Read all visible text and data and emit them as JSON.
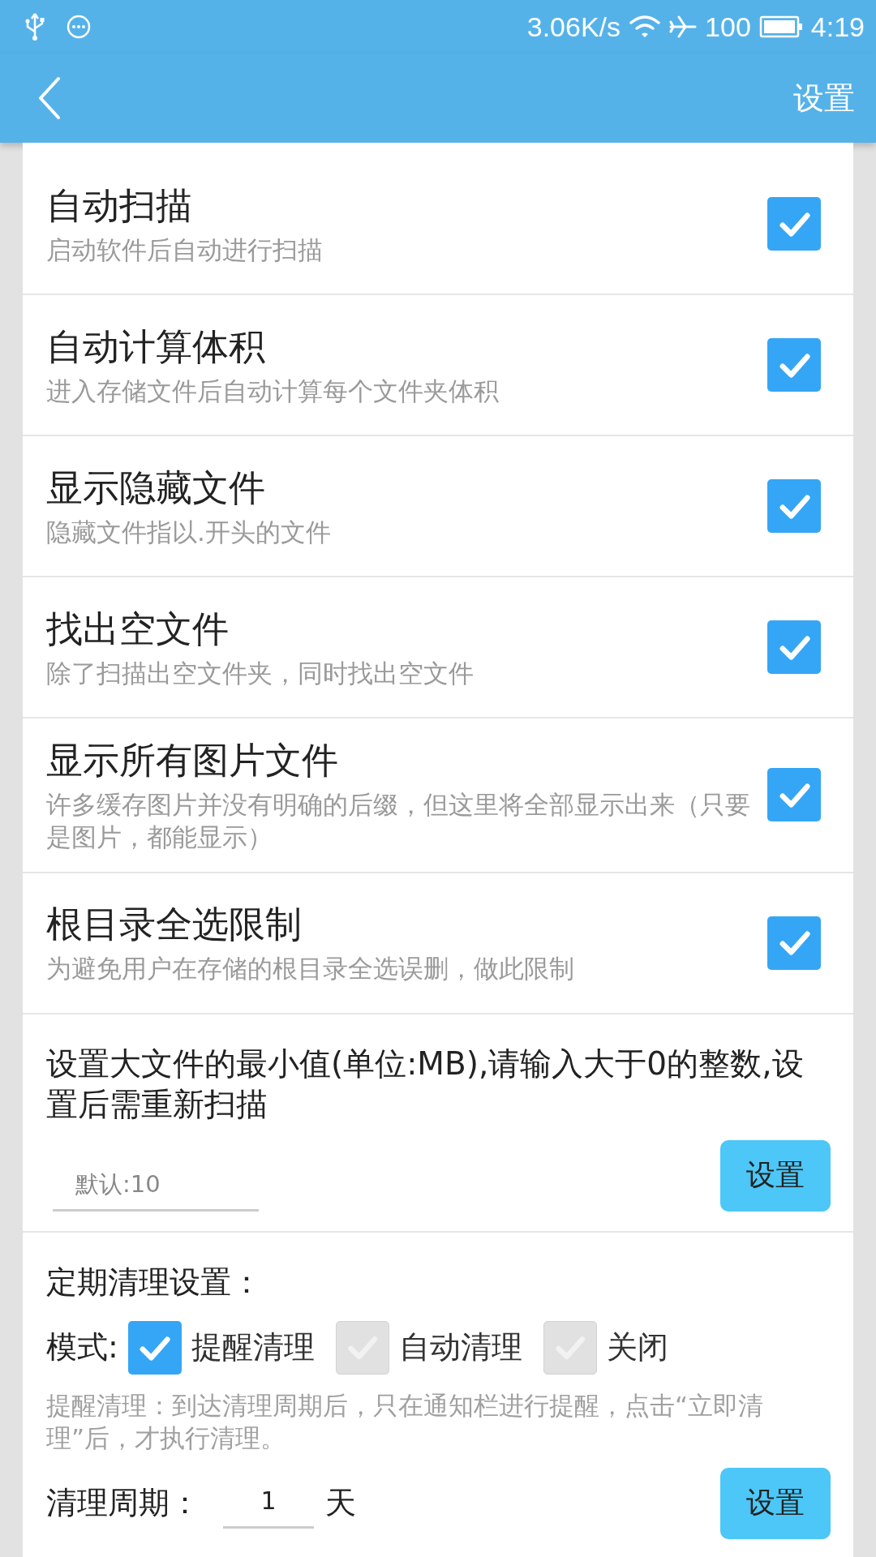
{
  "status_bar": {
    "network_speed": "3.06K/s",
    "battery": "100",
    "time": "4:19"
  },
  "app_bar": {
    "title": "设置"
  },
  "settings": [
    {
      "title": "自动扫描",
      "subtitle": "启动软件后自动进行扫描",
      "checked": true
    },
    {
      "title": "自动计算体积",
      "subtitle": "进入存储文件后自动计算每个文件夹体积",
      "checked": true
    },
    {
      "title": "显示隐藏文件",
      "subtitle": "隐藏文件指以.开头的文件",
      "checked": true
    },
    {
      "title": "找出空文件",
      "subtitle": "除了扫描出空文件夹，同时找出空文件",
      "checked": true
    },
    {
      "title": "显示所有图片文件",
      "subtitle": "许多缓存图片并没有明确的后缀，但这里将全部显示出来（只要是图片，都能显示）",
      "checked": true
    },
    {
      "title": "根目录全选限制",
      "subtitle": "为避免用户在存储的根目录全选误删，做此限制",
      "checked": true
    }
  ],
  "big_file": {
    "label": "设置大文件的最小值(单位:MB),请输入大于0的整数,设置后需重新扫描",
    "placeholder": "默认:10",
    "button": "设置"
  },
  "cleanup": {
    "title": "定期清理设置：",
    "mode_label": "模式:",
    "modes": [
      {
        "label": "提醒清理",
        "selected": true
      },
      {
        "label": "自动清理",
        "selected": false
      },
      {
        "label": "关闭",
        "selected": false
      }
    ],
    "description": "提醒清理：到达清理周期后，只在通知栏进行提醒，点击“立即清理”后，才执行清理。",
    "period_label": "清理周期：",
    "period_value": "1",
    "period_unit": "天",
    "button": "设置"
  }
}
